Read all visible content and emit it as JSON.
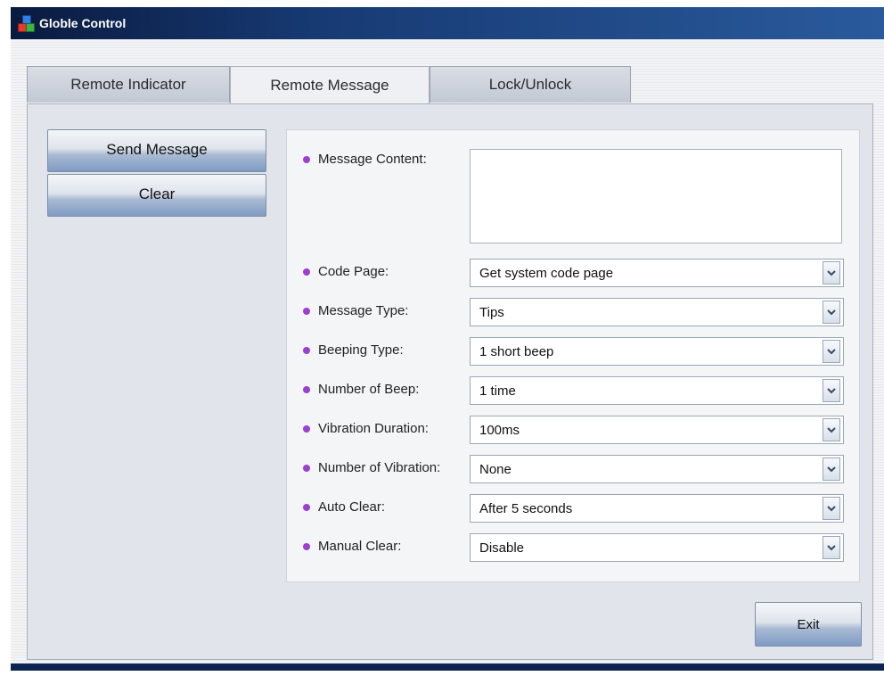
{
  "window": {
    "title": "Globle Control"
  },
  "tabs": [
    {
      "label": "Remote Indicator"
    },
    {
      "label": "Remote Message"
    },
    {
      "label": "Lock/Unlock"
    }
  ],
  "active_tab": "Remote Message",
  "actions": {
    "send_label": "Send Message",
    "clear_label": "Clear",
    "exit_label": "Exit"
  },
  "form": {
    "message_content": {
      "label": "Message Content:",
      "value": ""
    },
    "code_page": {
      "label": "Code Page:",
      "value": "Get system code page"
    },
    "message_type": {
      "label": "Message Type:",
      "value": "Tips"
    },
    "beeping_type": {
      "label": "Beeping Type:",
      "value": "1 short beep"
    },
    "number_of_beep": {
      "label": "Number of Beep:",
      "value": "1 time"
    },
    "vibration_duration": {
      "label": "Vibration Duration:",
      "value": "100ms"
    },
    "number_of_vibration": {
      "label": "Number of Vibration:",
      "value": "None"
    },
    "auto_clear": {
      "label": "Auto Clear:",
      "value": "After 5 seconds"
    },
    "manual_clear": {
      "label": "Manual Clear:",
      "value": "Disable"
    }
  },
  "colors": {
    "bullet": "#9b3fd1",
    "titlebar": "#173a73"
  }
}
